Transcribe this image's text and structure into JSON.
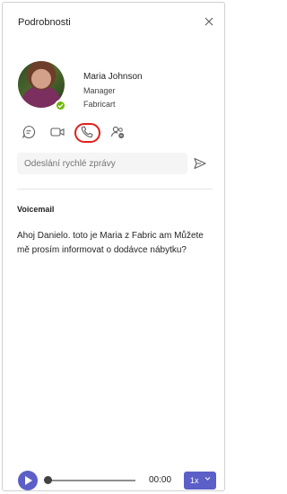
{
  "panel": {
    "title": "Podrobnosti",
    "close_icon": "close-icon"
  },
  "contact": {
    "name": "Maria Johnson",
    "role": "Manager",
    "company": "Fabricart",
    "presence": "available",
    "presence_color": "#6bb700"
  },
  "actions": [
    {
      "name": "chat",
      "icon": "chat-icon"
    },
    {
      "name": "video",
      "icon": "video-icon"
    },
    {
      "name": "call",
      "icon": "phone-icon",
      "highlighted": true
    },
    {
      "name": "people",
      "icon": "people-settings-icon"
    }
  ],
  "quick_message": {
    "placeholder": "Odeslání rychlé zprávy",
    "send_icon": "send-icon"
  },
  "voicemail": {
    "title": "Voicemail",
    "transcript": "Ahoj Danielo. toto je Maria z Fabric am Můžete mě prosím informovat o dodávce nábytku?"
  },
  "player": {
    "time": "00:00",
    "speed": "1x",
    "progress": 0,
    "accent": "#5b5fc7"
  },
  "colors": {
    "highlight": "#e0211c",
    "accent": "#5b5fc7"
  }
}
